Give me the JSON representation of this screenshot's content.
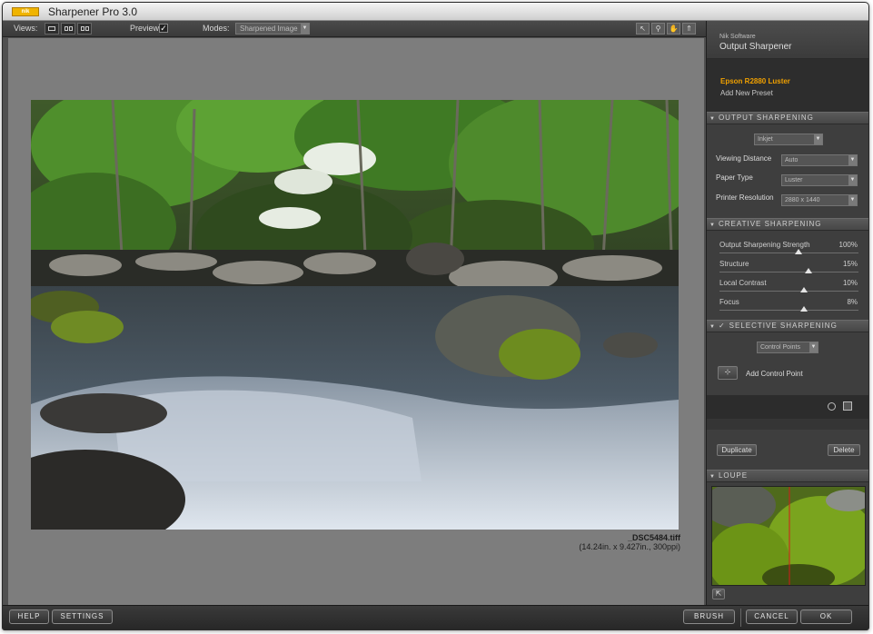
{
  "app": {
    "logo_text": "nik software",
    "title": "Sharpener Pro 3.0"
  },
  "toolbar": {
    "views_label": "Views:",
    "preview_label": "Preview:",
    "preview_checked": "✓",
    "modes_label": "Modes:",
    "mode_value": "Sharpened Image"
  },
  "image": {
    "filename": "_DSC5484.tiff",
    "dimensions": "(14.24in. x 9.427in., 300ppi)"
  },
  "panel": {
    "brand": "Nik Software",
    "filter_name": "Output Sharpener",
    "preset_active": "Epson R2880 Luster",
    "preset_add": "Add New Preset",
    "output_section": {
      "header": "OUTPUT SHARPENING",
      "output_type": "Inkjet",
      "viewing_distance_label": "Viewing Distance",
      "viewing_distance_value": "Auto",
      "paper_type_label": "Paper Type",
      "paper_type_value": "Luster",
      "printer_resolution_label": "Printer Resolution",
      "printer_resolution_value": "2880 x 1440"
    },
    "creative_section": {
      "header": "CREATIVE SHARPENING",
      "sliders": [
        {
          "label": "Output Sharpening Strength",
          "value": "100%",
          "fraction": 0.57
        },
        {
          "label": "Structure",
          "value": "15%",
          "fraction": 0.64
        },
        {
          "label": "Local Contrast",
          "value": "10%",
          "fraction": 0.61
        },
        {
          "label": "Focus",
          "value": "8%",
          "fraction": 0.61
        }
      ]
    },
    "selective_section": {
      "header": "SELECTIVE SHARPENING",
      "check": "✓",
      "mode_value": "Control Points",
      "add_control_point": "Add Control Point"
    },
    "duplicate_label": "Duplicate",
    "delete_label": "Delete",
    "loupe_header": "LOUPE"
  },
  "bottom": {
    "help": "HELP",
    "settings": "SETTINGS",
    "brush": "BRUSH",
    "cancel": "CANCEL",
    "ok": "OK"
  },
  "colors": {
    "accent": "#f0a000",
    "panel_bg": "#3e3e3e",
    "canvas_bg": "#7d7d7d"
  }
}
